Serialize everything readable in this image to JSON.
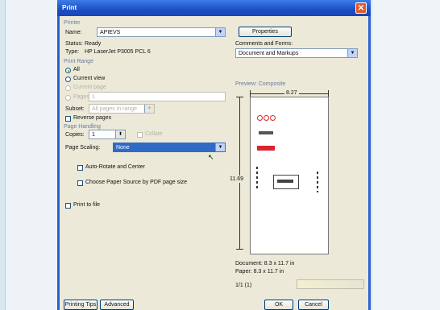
{
  "window": {
    "title": "Print"
  },
  "printer": {
    "section": "Printer",
    "name_label": "Name:",
    "name_value": "APIEVS",
    "status_label": "Status:",
    "status_value": "Ready",
    "type_label": "Type:",
    "type_value": "HP LaserJet P3005 PCL 6",
    "properties_label": "Properties",
    "comments_forms_label": "Comments and Forms:",
    "comments_forms_value": "Document and Markups"
  },
  "print_range": {
    "section": "Print Range",
    "all": "All",
    "current_view": "Current view",
    "current_page": "Current page",
    "pages_label": "Pages",
    "pages_value": "1",
    "subset_label": "Subset:",
    "subset_value": "All pages in range",
    "reverse_pages": "Reverse pages"
  },
  "page_handling": {
    "section": "Page Handling",
    "copies_label": "Copies:",
    "copies_value": "1",
    "collate_label": "Collate",
    "page_scaling_label": "Page Scaling:",
    "page_scaling_value": "None",
    "auto_rotate": "Auto-Rotate and Center",
    "choose_paper_source": "Choose Paper Source by PDF page size"
  },
  "print_to_file": "Print to file",
  "preview": {
    "label": "Preview: Composite",
    "width": "8.27",
    "height": "11.69",
    "document_size": "Document: 8.3 x 11.7 in",
    "paper_size": "Paper: 8.3 x 11.7 in",
    "page_indicator": "1/1 (1)"
  },
  "buttons": {
    "printing_tips": "Printing Tips",
    "advanced": "Advanced",
    "ok": "OK",
    "cancel": "Cancel"
  },
  "colors": {
    "title_bar": "#1c4fc4",
    "dialog_bg": "#ece9d8",
    "selection": "#316ac5",
    "logo_red": "#d8262e"
  }
}
